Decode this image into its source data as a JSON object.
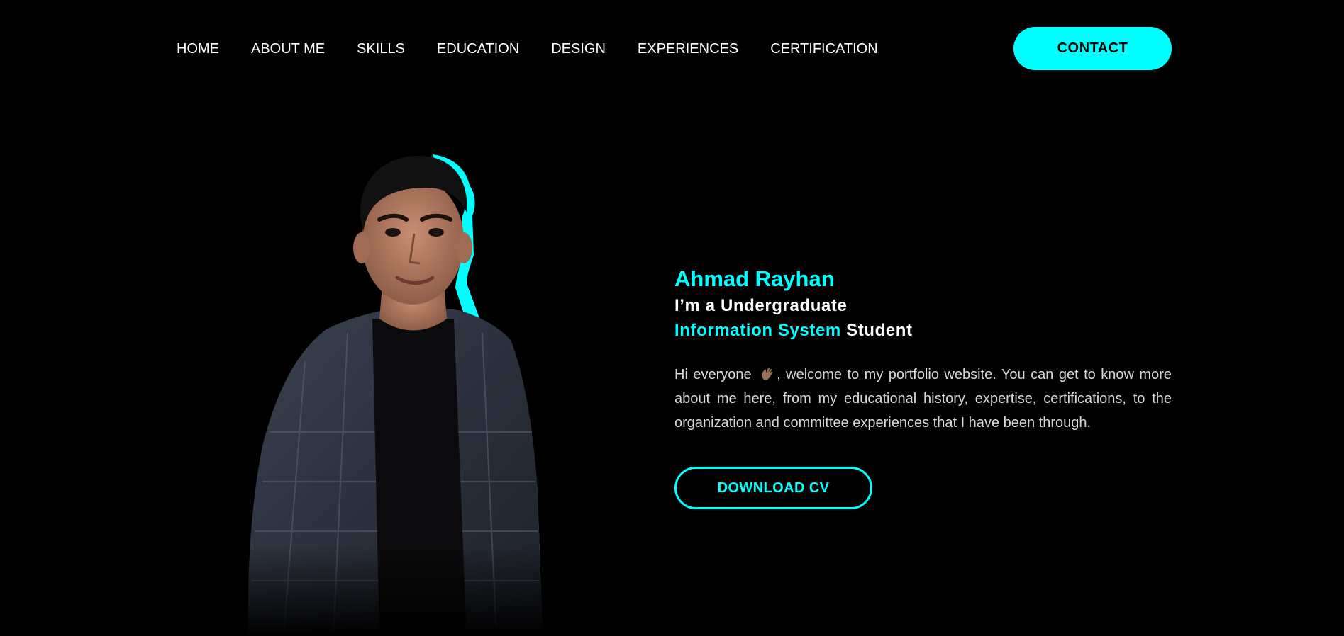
{
  "nav": {
    "items": [
      {
        "label": "HOME"
      },
      {
        "label": "ABOUT ME"
      },
      {
        "label": "SKILLS"
      },
      {
        "label": "EDUCATION"
      },
      {
        "label": "DESIGN"
      },
      {
        "label": "EXPERIENCES"
      },
      {
        "label": "CERTIFICATION"
      }
    ],
    "contact_label": "CONTACT"
  },
  "hero": {
    "name": "Ahmad Rayhan",
    "line1": "I’m a Undergraduate",
    "line2_accent": "Information System",
    "line2_rest": " Student",
    "desc_before_icon": "Hi everyone ",
    "icon": "waving-hand-icon",
    "desc_after_icon": ", welcome to my portfolio website. You can get to know more about me here, from my educational history, expertise, certifications, to the organization and committee experiences that I have been through.",
    "cv_label": "DOWNLOAD CV"
  },
  "colors": {
    "accent": "#00ffff",
    "background": "#000000",
    "text": "#ffffff"
  }
}
